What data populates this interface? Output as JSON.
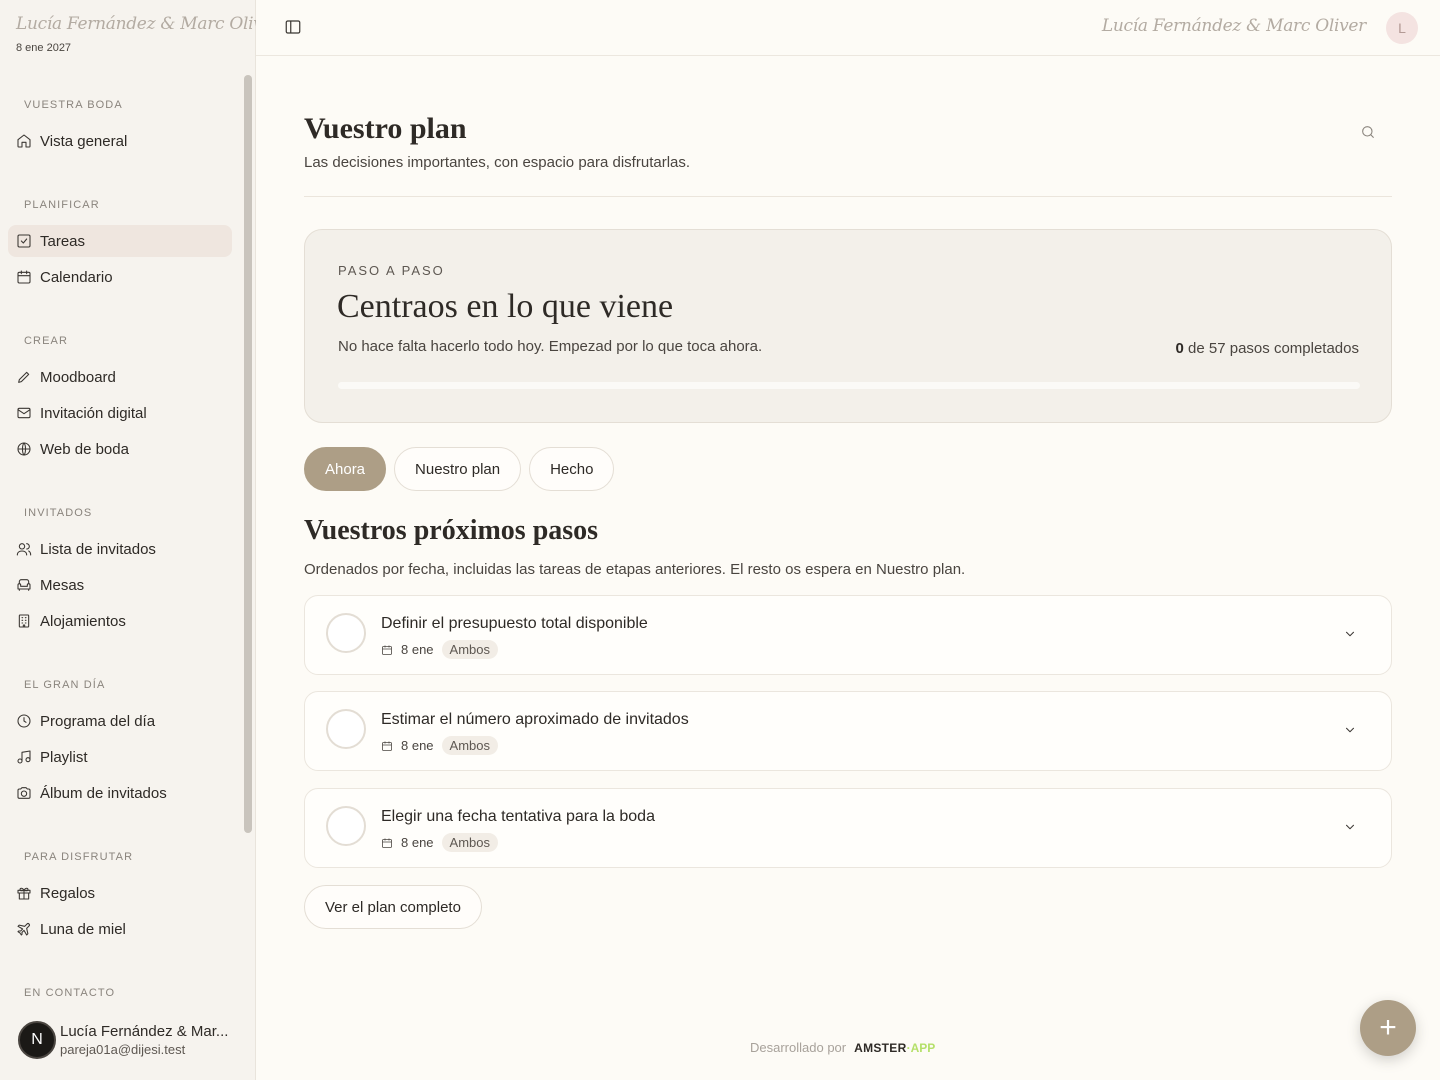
{
  "brand": {
    "couple": "Lucía Fernández & Marc Oliver",
    "date": "8 ene 2027"
  },
  "sidebar": {
    "sections": [
      {
        "title": "Vuestra boda"
      },
      {
        "title": "Planificar"
      },
      {
        "title": "Crear"
      },
      {
        "title": "Invitados"
      },
      {
        "title": "El gran día"
      },
      {
        "title": "Para disfrutar"
      },
      {
        "title": "En contacto"
      }
    ],
    "items": [
      {
        "label": "Vista general",
        "icon": "home-icon"
      },
      {
        "label": "Tareas",
        "icon": "checkbox-icon",
        "active": true
      },
      {
        "label": "Calendario",
        "icon": "calendar-icon"
      },
      {
        "label": "Moodboard",
        "icon": "pencil-icon"
      },
      {
        "label": "Invitación digital",
        "icon": "mail-icon"
      },
      {
        "label": "Web de boda",
        "icon": "globe-icon"
      },
      {
        "label": "Lista de invitados",
        "icon": "users-icon"
      },
      {
        "label": "Mesas",
        "icon": "sofa-icon"
      },
      {
        "label": "Alojamientos",
        "icon": "building-icon"
      },
      {
        "label": "Programa del día",
        "icon": "clock-icon"
      },
      {
        "label": "Playlist",
        "icon": "music-icon"
      },
      {
        "label": "Álbum de invitados",
        "icon": "camera-icon"
      },
      {
        "label": "Regalos",
        "icon": "gift-icon"
      },
      {
        "label": "Luna de miel",
        "icon": "plane-icon"
      }
    ],
    "user": {
      "initial": "N",
      "name": "Lucía Fernández & Mar...",
      "email": "pareja01a@dijesi.test"
    }
  },
  "topbar": {
    "couple": "Lucía Fernández & Marc Oliver",
    "avatar_initial": "L"
  },
  "page": {
    "title": "Vuestro plan",
    "subtitle": "Las decisiones importantes, con espacio para disfrutarlas."
  },
  "hero": {
    "eyebrow": "PASO A PASO",
    "title": "Centraos en lo que viene",
    "description": "No hace falta hacerlo todo hoy. Empezad por lo que toca ahora.",
    "completed": "0",
    "count_suffix": " de 57 pasos completados",
    "progress_fraction": 0
  },
  "tabs": [
    {
      "label": "Ahora",
      "active": true
    },
    {
      "label": "Nuestro plan",
      "active": false
    },
    {
      "label": "Hecho",
      "active": false
    }
  ],
  "next_steps": {
    "title": "Vuestros próximos pasos",
    "subtitle": "Ordenados por fecha, incluidas las tareas de etapas anteriores. El resto os espera en Nuestro plan.",
    "tasks": [
      {
        "title": "Definir el presupuesto total disponible",
        "date": "8 ene",
        "assignee": "Ambos"
      },
      {
        "title": "Estimar el número aproximado de invitados",
        "date": "8 ene",
        "assignee": "Ambos"
      },
      {
        "title": "Elegir una fecha tentativa para la boda",
        "date": "8 ene",
        "assignee": "Ambos"
      }
    ],
    "see_all_label": "Ver el plan completo"
  },
  "footer": {
    "developed_by": "Desarrollado por",
    "brand_main": "AMSTER",
    "brand_accent": "APP"
  },
  "colors": {
    "accent": "#ad9e86",
    "background": "#fdfbf6",
    "sidebar": "#f6f3ee",
    "brand_accent": "#b5e06a"
  }
}
